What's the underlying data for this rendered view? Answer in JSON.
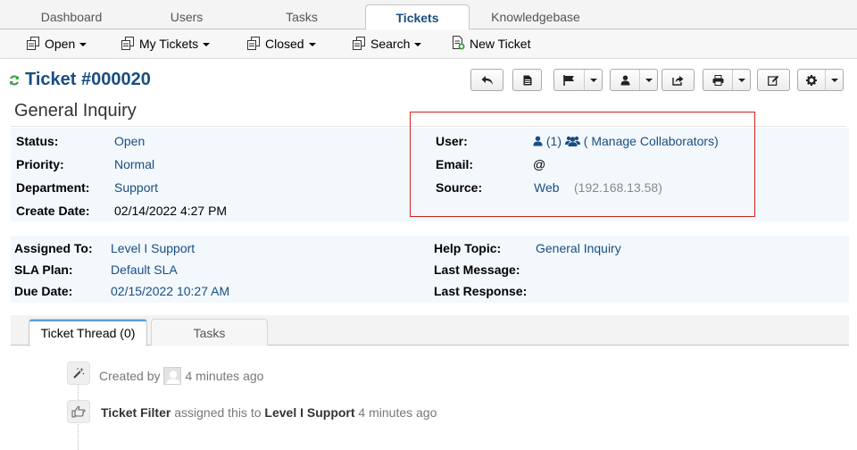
{
  "nav": {
    "tabs": [
      {
        "label": "Dashboard"
      },
      {
        "label": "Users"
      },
      {
        "label": "Tasks"
      },
      {
        "label": "Tickets",
        "active": true
      },
      {
        "label": "Knowledgebase"
      }
    ]
  },
  "subnav": {
    "open": "Open",
    "my_tickets": "My Tickets",
    "closed": "Closed",
    "search": "Search",
    "new_ticket": "New Ticket"
  },
  "ticket": {
    "number": "Ticket #000020",
    "subject": "General Inquiry",
    "toolbar_icons": [
      "reply-icon",
      "document-icon",
      "flag-icon",
      "user-icon",
      "share-icon",
      "print-icon",
      "edit-icon",
      "gear-icon"
    ]
  },
  "info1": {
    "status_label": "Status:",
    "status": "Open",
    "priority_label": "Priority:",
    "priority": "Normal",
    "department_label": "Department:",
    "department": "Support",
    "create_date_label": "Create Date:",
    "create_date": "02/14/2022 4:27 PM",
    "user_label": "User:",
    "user_count": "(1)",
    "manage_collaborators": "( Manage Collaborators)",
    "email_label": "Email:",
    "email": "@",
    "source_label": "Source:",
    "source": "Web",
    "source_ip": "(192.168.13.58)"
  },
  "info2": {
    "assigned_label": "Assigned To:",
    "assigned": "Level I Support",
    "sla_label": "SLA Plan:",
    "sla": "Default SLA",
    "due_label": "Due Date:",
    "due": "02/15/2022 10:27 AM",
    "help_topic_label": "Help Topic:",
    "help_topic": "General Inquiry",
    "last_message_label": "Last Message:",
    "last_message": "",
    "last_response_label": "Last Response:",
    "last_response": ""
  },
  "thread_tabs": {
    "thread": "Ticket Thread (0)",
    "tasks": "Tasks"
  },
  "thread": {
    "created_by": "Created by",
    "created_time": "4 minutes ago",
    "filter_name": "Ticket Filter",
    "filter_action": "assigned this to",
    "filter_target": "Level I Support",
    "filter_time": "4 minutes ago"
  },
  "colors": {
    "link": "#184e81",
    "panel_bg": "#f3f8fd",
    "highlight": "#d42020",
    "refresh_icon": "#3a9a3a"
  }
}
